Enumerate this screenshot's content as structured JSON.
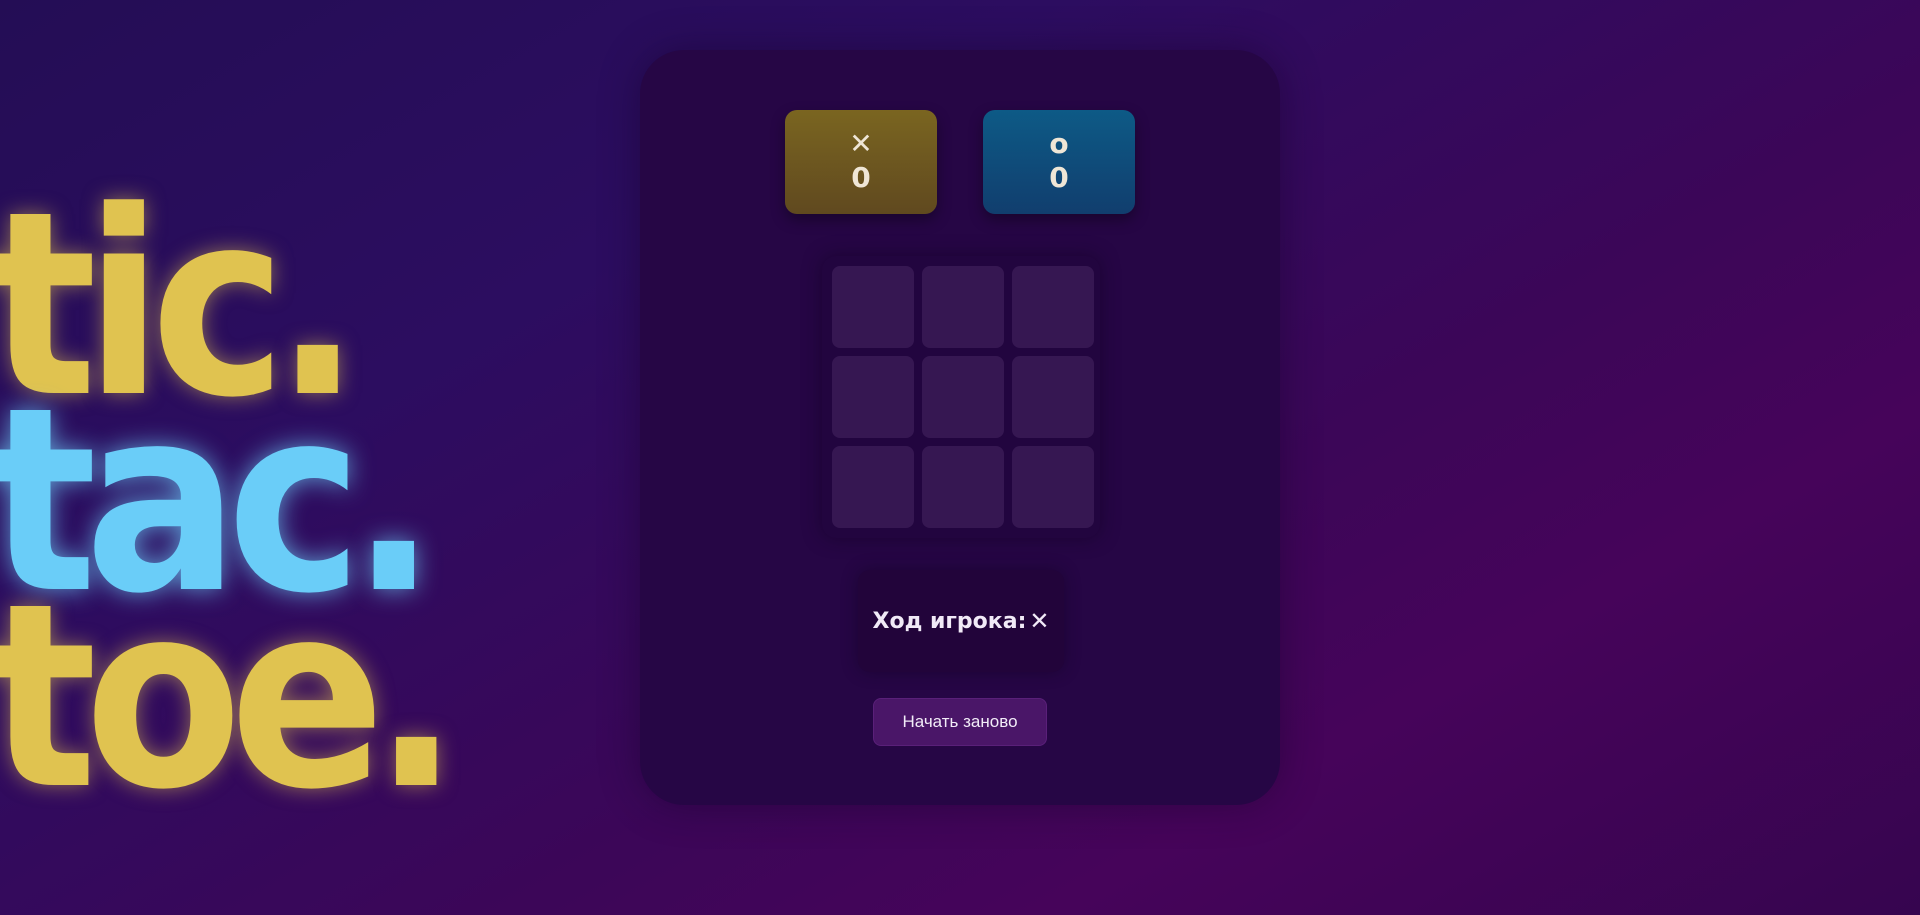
{
  "title_lines": [
    "tic.",
    "tac.",
    "toe."
  ],
  "scoreboard": {
    "x": {
      "symbol": "✕",
      "score": "0"
    },
    "o": {
      "symbol": "o",
      "score": "0"
    }
  },
  "board": {
    "cells": [
      "",
      "",
      "",
      "",
      "",
      "",
      "",
      "",
      ""
    ]
  },
  "status": {
    "label": "Ход игрока:",
    "current_symbol": "✕"
  },
  "restart_button": {
    "label": "Начать заново"
  },
  "colors": {
    "accent_yellow": "#e0c350",
    "accent_blue": "#6acdf8",
    "card": "#260645",
    "cell": "#361752",
    "button": "#4a1668"
  }
}
